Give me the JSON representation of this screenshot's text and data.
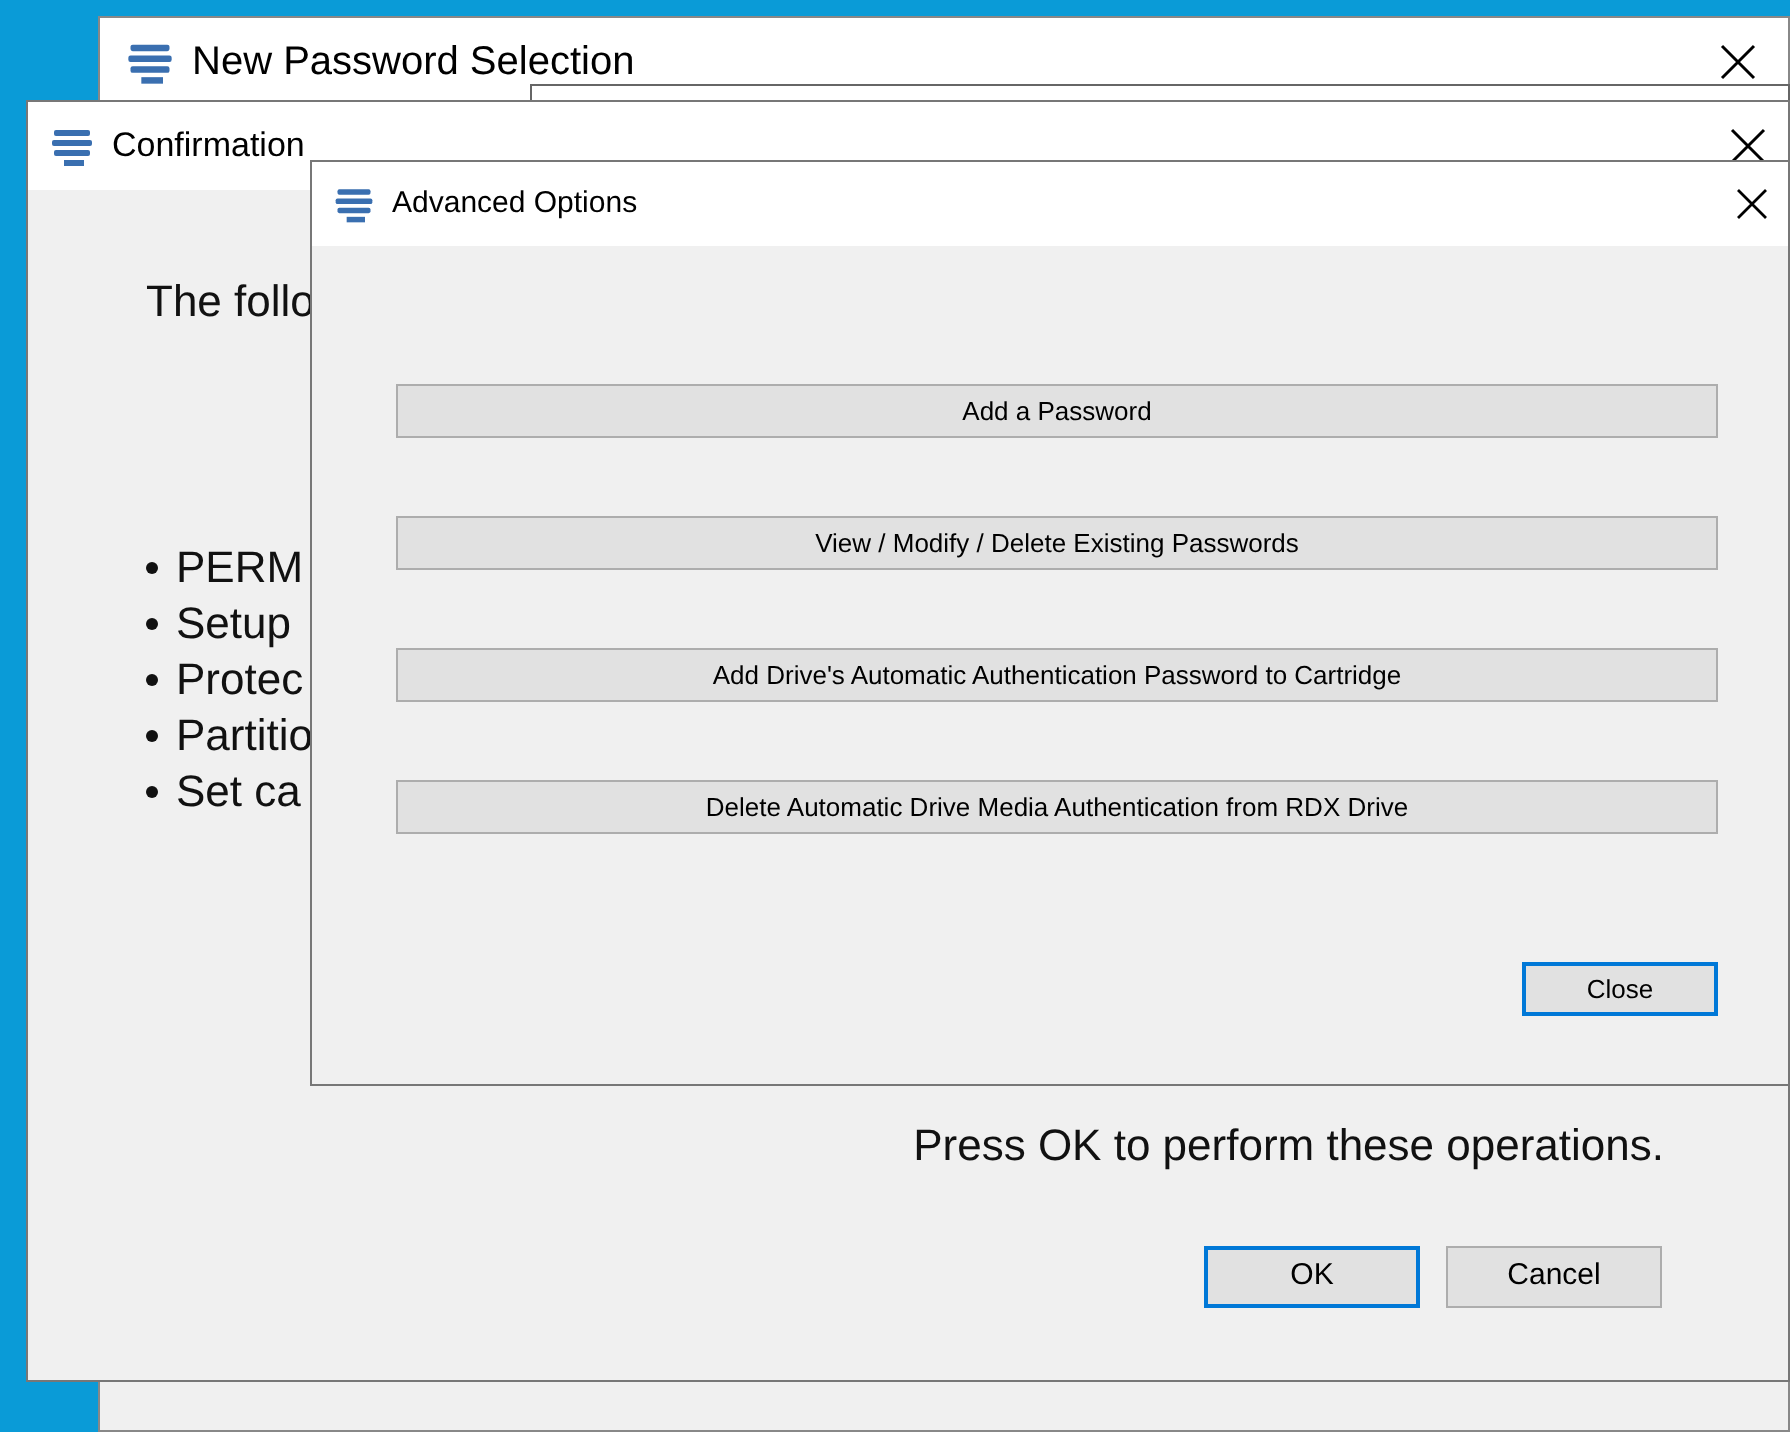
{
  "background_window": {
    "title": "New Password Selection"
  },
  "confirmation": {
    "title": "Confirmation",
    "intro": "The follo",
    "items": [
      "PERM",
      "Setup",
      "Protec",
      "Partitio",
      "Set ca"
    ],
    "prompt": "Press OK to perform these operations.",
    "buttons": [
      {
        "label": "OK",
        "default": true
      },
      {
        "label": "Cancel",
        "default": false
      }
    ]
  },
  "advanced_options": {
    "title": "Advanced Options",
    "options": [
      "Add a Password",
      "View / Modify / Delete Existing Passwords",
      "Add Drive's Automatic Authentication Password to Cartridge",
      "Delete Automatic Drive Media Authentication from RDX Drive"
    ],
    "buttons": [
      {
        "label": "Close",
        "default": true
      }
    ]
  }
}
